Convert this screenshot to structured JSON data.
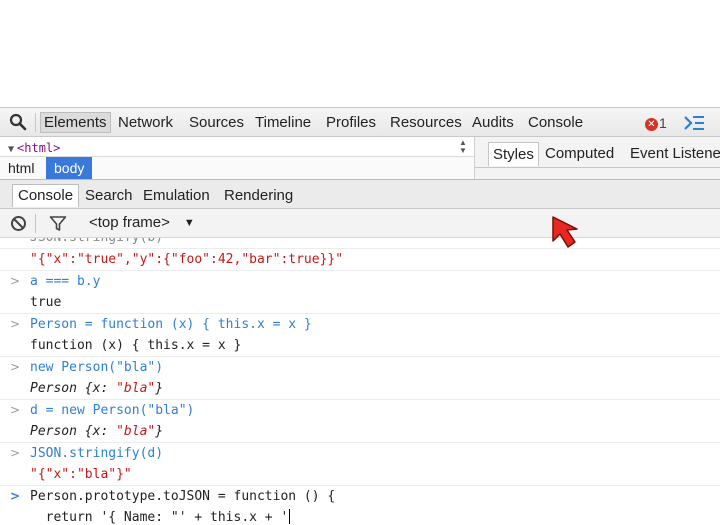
{
  "toolbar": {
    "tabs": [
      "Elements",
      "Network",
      "Sources",
      "Timeline",
      "Profiles",
      "Resources",
      "Audits",
      "Console"
    ],
    "error_count": "1",
    "icons": {
      "search": "search-icon",
      "error": "error-icon",
      "drawer": "show-drawer-icon"
    },
    "colors": {
      "error": "#d93025",
      "accent": "#3879d9"
    }
  },
  "dom": {
    "html_tag": "<html>",
    "breadcrumbs": [
      "html",
      "body"
    ]
  },
  "styles_pane": {
    "tabs": [
      "Styles",
      "Computed",
      "Event Listeners"
    ]
  },
  "drawer": {
    "tabs": [
      "Console",
      "Search",
      "Emulation",
      "Rendering"
    ]
  },
  "console_bar": {
    "frame": "<top frame>",
    "icons": {
      "clear": "clear-console-icon",
      "filter": "filter-icon"
    }
  },
  "console": {
    "partial_line": "JSON.stringify(b)",
    "entries": [
      {
        "output": "\"{\"x\":\"true\",\"y\":{\"foo\":42,\"bar\":true}}\""
      },
      {
        "input": "a === b.y",
        "output": "true"
      },
      {
        "input": "Person = function (x) { this.x = x }",
        "output": "function (x) { this.x = x }"
      },
      {
        "input": "new Person(\"bla\")",
        "output_type": "Person",
        "output_key": "x:",
        "output_value": "\"bla\""
      },
      {
        "input": "d = new Person(\"bla\")",
        "output_type": "Person",
        "output_key": "x:",
        "output_value": "\"bla\""
      },
      {
        "input": "JSON.stringify(d)",
        "output": "\"{\"x\":\"bla\"}\""
      }
    ],
    "prompt_lines": [
      "Person.prototype.toJSON = function () {",
      "  return '{ Name: \"' + this.x + '"
    ]
  }
}
